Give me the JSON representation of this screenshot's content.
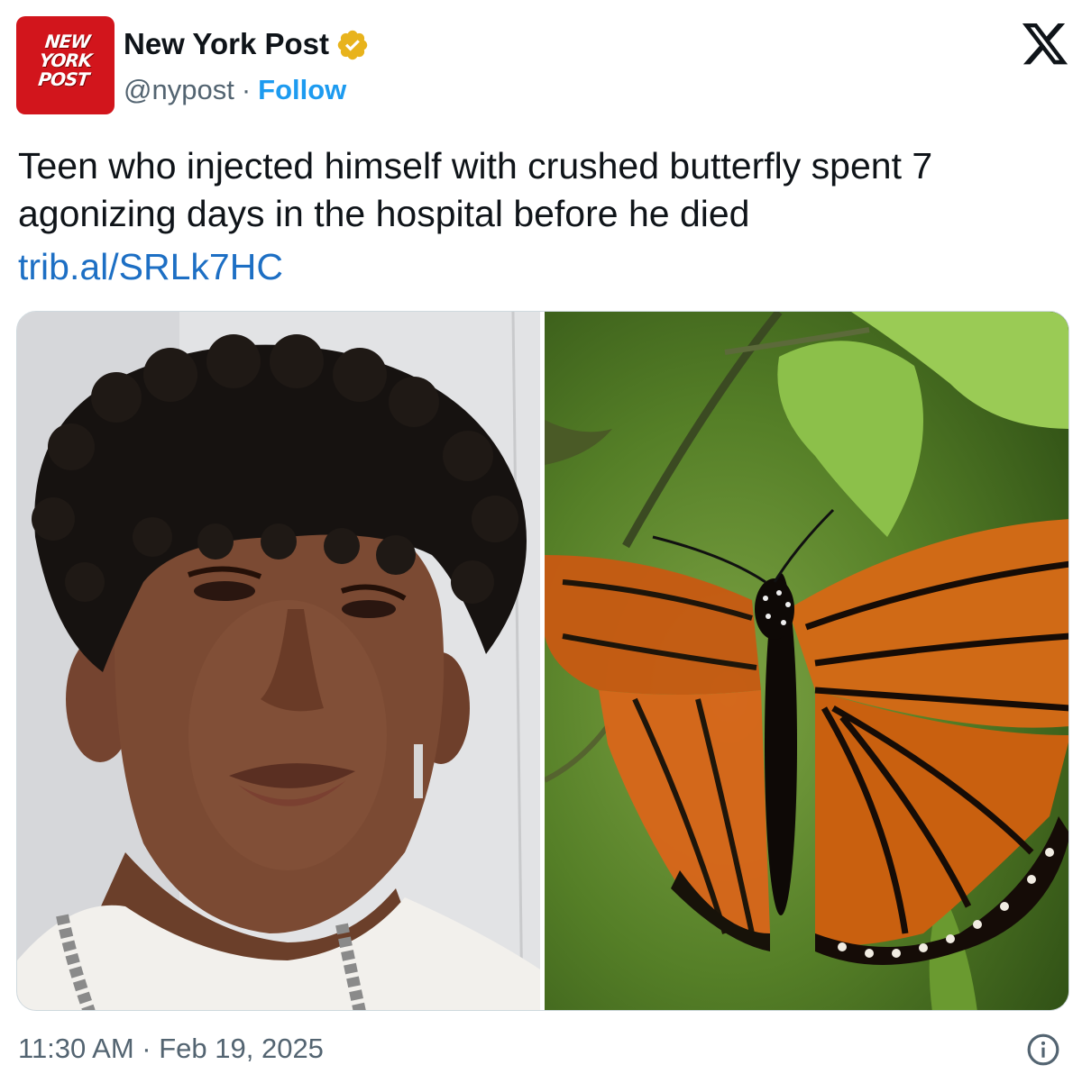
{
  "author": {
    "display_name": "New York Post",
    "handle": "@nypost",
    "separator": "·",
    "follow_label": "Follow",
    "avatar_logo_lines": [
      "NEW",
      "YORK",
      "POST"
    ],
    "verified_icon": "gold-verified-badge-icon",
    "brand_color": "#d2151c"
  },
  "platform": {
    "logo_icon": "x-logo-icon"
  },
  "tweet": {
    "text": "Teen who injected himself with crushed butterfly spent 7 agonizing days in the hospital before he died",
    "link": "trib.al/SRLk7HC"
  },
  "media": {
    "images": [
      {
        "content": "portrait-photo"
      },
      {
        "content": "monarch-butterfly-photo"
      }
    ]
  },
  "footer": {
    "timestamp": "11:30 AM · Feb 19, 2025",
    "info_icon": "info-icon"
  },
  "colors": {
    "text": "#0f1419",
    "secondary": "#536471",
    "link": "#1d6fc4",
    "follow": "#1d9bf0"
  }
}
